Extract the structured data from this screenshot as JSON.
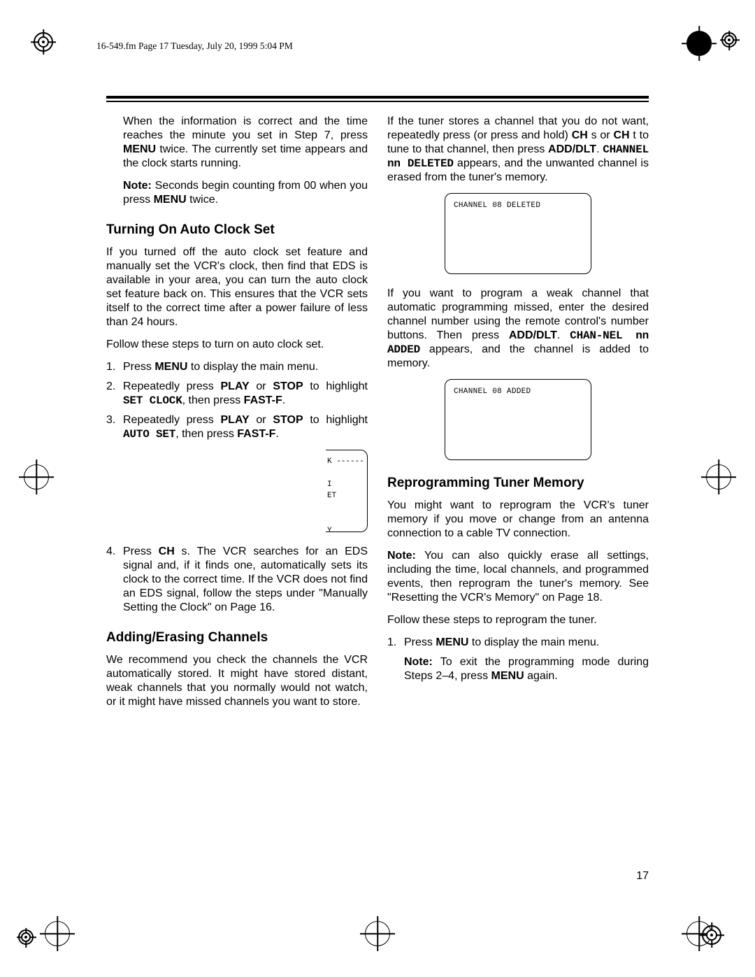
{
  "header_info": "16-549.fm  Page 17  Tuesday, July 20, 1999  5:04 PM",
  "page_number": "17",
  "left_col": {
    "p1": {
      "t1": "When the information is correct and the time reaches the minute you set in Step 7, press ",
      "b1": "MENU",
      "t2": " twice. The currently set time appears and the clock starts running."
    },
    "p2": {
      "t1": "Note:",
      "t2": " Seconds begin counting from 00 when you press ",
      "b1": "MENU",
      "t3": " twice."
    },
    "h1": "Turning On Auto Clock Set",
    "p3": "If you turned off the auto clock set feature and manually set the VCR's clock, then find that EDS is available in your area, you can turn the auto clock set feature back on. This ensures that the VCR sets itself to the correct time after a power failure of less than 24 hours.",
    "p4": "Follow these steps to turn on auto clock set.",
    "s1": {
      "t1": "Press ",
      "b1": "MENU",
      "t2": " to display the main menu."
    },
    "s2": {
      "t1": "Repeatedly press ",
      "b1": "PLAY",
      "t2": " or ",
      "b2": "STOP",
      "t3": " to highlight ",
      "m1": "SET CLOCK",
      "t4": ", then press ",
      "b3": "FAST-F",
      "t5": "."
    },
    "s3": {
      "t1": "Repeatedly press ",
      "b1": "PLAY",
      "t2": " or ",
      "b2": "STOP",
      "t3": " to highlight ",
      "m1": "AUTO SET",
      "t4": ", then press ",
      "b3": "FAST-F",
      "t5": "."
    },
    "screen_clip": "K ------\n\nI\nET\n\n\nY",
    "s4": {
      "t1": "Press ",
      "b1": "CH",
      "t2": " s. The VCR searches for an EDS signal and, if it finds one, automatically sets its clock to the correct time. If the VCR does not find an EDS signal, follow the steps under \"Manually Setting the Clock\" on Page 16."
    },
    "h2": "Adding/Erasing Channels",
    "p5": "We recommend you check the channels the VCR automatically stored. It might have stored distant, weak channels that you normally would not watch, or it might have missed channels you want to store."
  },
  "right_col": {
    "p1": {
      "t1": "If the tuner stores a channel that you do not want, repeatedly press (or press and hold) ",
      "b1": "CH",
      "t2": " s or ",
      "b2": "CH",
      "t3": " t to tune to that channel, then press ",
      "b3": "ADD/DLT",
      "t4": ". ",
      "m1": "CHANNEL nn DELETED",
      "t5": " appears, and the unwanted channel is erased from the tuner's memory."
    },
    "screen1": "CHANNEL 08 DELETED",
    "p2": {
      "t1": "If you want to program a weak channel that automatic programming missed, enter the desired channel number using the remote control's number buttons. Then press ",
      "b1": "ADD/DLT",
      "t2": ". ",
      "m1": "CHAN-NEL nn ADDED",
      "t3": " appears, and the channel is added to memory."
    },
    "screen2": "CHANNEL 08 ADDED",
    "h1": "Reprogramming Tuner Memory",
    "p3": "You might want to reprogram the VCR's tuner memory if you move or change from an antenna connection to a cable TV connection.",
    "p4": {
      "t1": "Note:",
      "t2": " You can also quickly erase all settings, including the time, local channels, and programmed events, then reprogram the tuner's memory. See \"Resetting the VCR's Memory\" on Page 18."
    },
    "p5": "Follow these steps to reprogram the tuner.",
    "s1": {
      "t1": "Press ",
      "b1": "MENU",
      "t2": " to display the main menu."
    },
    "s1n": {
      "t1": "Note:",
      "t2": " To exit the programming mode during Steps 2–4, press ",
      "b1": "MENU",
      "t3": " again."
    }
  }
}
